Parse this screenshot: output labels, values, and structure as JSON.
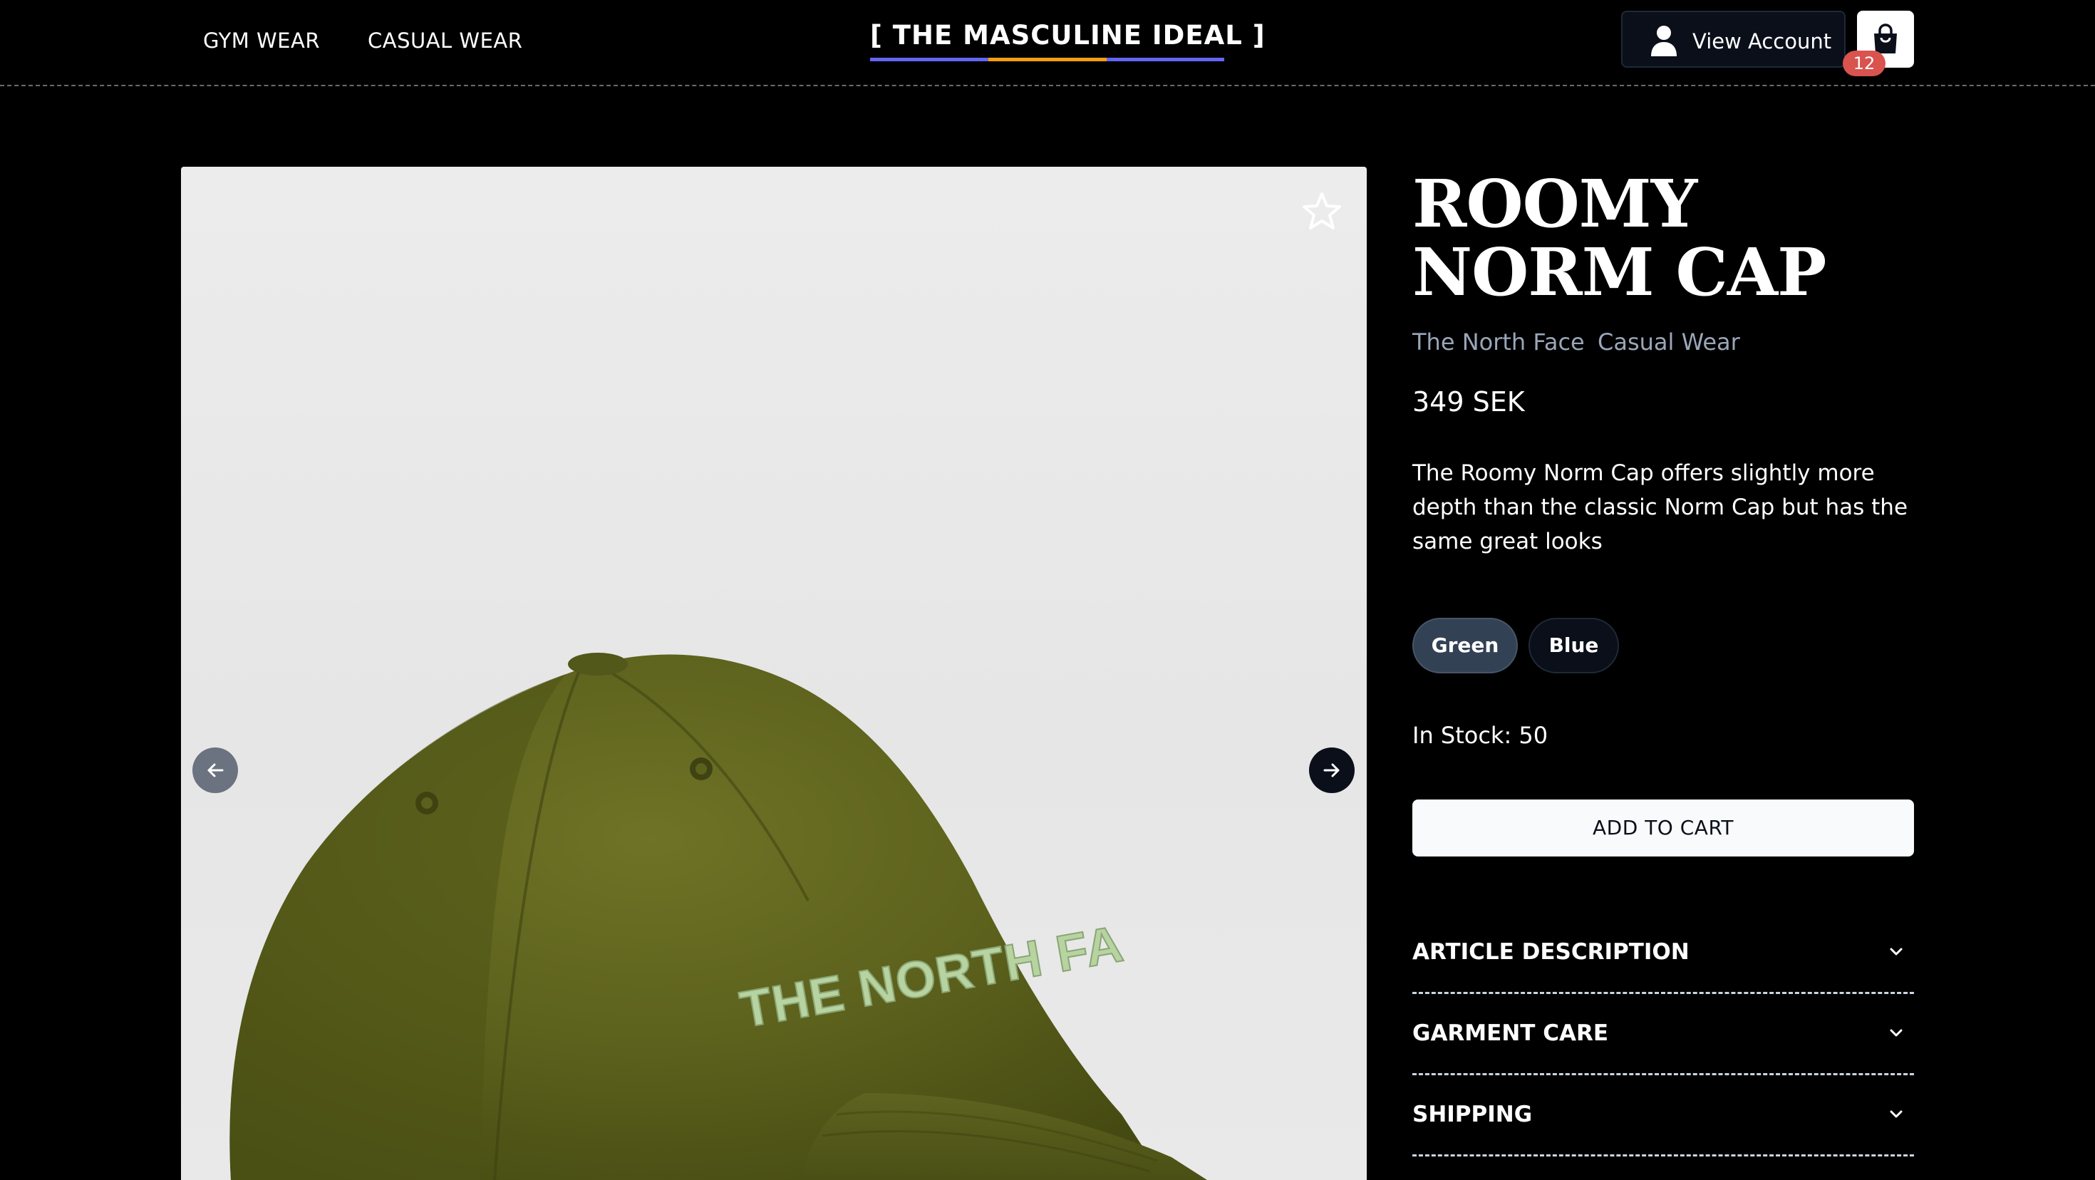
{
  "header": {
    "nav": [
      {
        "label": "GYM WEAR"
      },
      {
        "label": "CASUAL WEAR"
      }
    ],
    "logo": "[ THE MASCULINE IDEAL ]",
    "logo_bar_colors": [
      "#6366f1",
      "#f59e0b",
      "#6366f1"
    ],
    "account_label": "View Account",
    "account_icon": "user-icon",
    "cart_icon": "shopping-bag-icon",
    "cart_count": "12",
    "cart_badge_color": "#d9534f"
  },
  "gallery": {
    "favorite_icon": "star-outline-icon",
    "prev_icon": "arrow-left-icon",
    "next_icon": "arrow-right-icon",
    "cap_embroidery": "THE NORTH FA"
  },
  "product": {
    "title_line1": "ROOMY",
    "title_line2": "NORM CAP",
    "brand": "The North Face",
    "category": "Casual Wear",
    "price": "349 SEK",
    "description": "The Roomy Norm Cap offers slightly more depth than the classic Norm Cap but has the same great looks",
    "variants": [
      {
        "label": "Green",
        "selected": true
      },
      {
        "label": "Blue",
        "selected": false
      }
    ],
    "stock": "In Stock: 50",
    "add_to_cart": "ADD TO CART",
    "accordions": [
      {
        "label": "ARTICLE DESCRIPTION"
      },
      {
        "label": "GARMENT CARE"
      },
      {
        "label": "SHIPPING"
      }
    ]
  }
}
